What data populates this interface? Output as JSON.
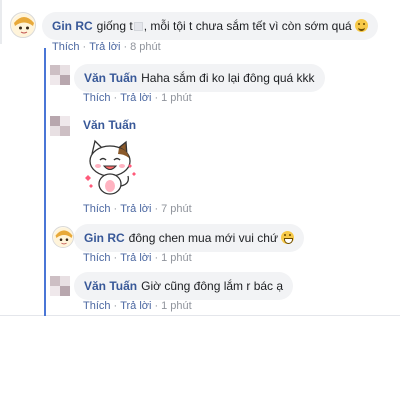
{
  "actions": {
    "like": "Thích",
    "reply": "Trả lời"
  },
  "colors": {
    "accent": "#4a76d6",
    "author": "#385898",
    "bubble": "#f2f3f5",
    "meta": "#90949c"
  },
  "comments": [
    {
      "author": "Gin RC",
      "text_before": "giống t",
      "text_after": ", mỗi tội t chưa sắm tết vì còn sớm quá",
      "emoji": "slightly-smiling-face",
      "time": "8 phút"
    },
    {
      "author": "Văn Tuấn",
      "text": "Haha sắm đi ko lại đông quá kkk",
      "time": "1 phút"
    },
    {
      "author": "Văn Tuấn",
      "sticker": "cat-sticker",
      "time": "7 phút"
    },
    {
      "author": "Gin RC",
      "text": "đông chen mua mới vui chứ",
      "emoji": "tears-of-joy-face",
      "time": "1 phút"
    },
    {
      "author": "Văn Tuấn",
      "text": "Giờ cũng đông lắm r bác ạ",
      "time": "1 phút"
    }
  ]
}
